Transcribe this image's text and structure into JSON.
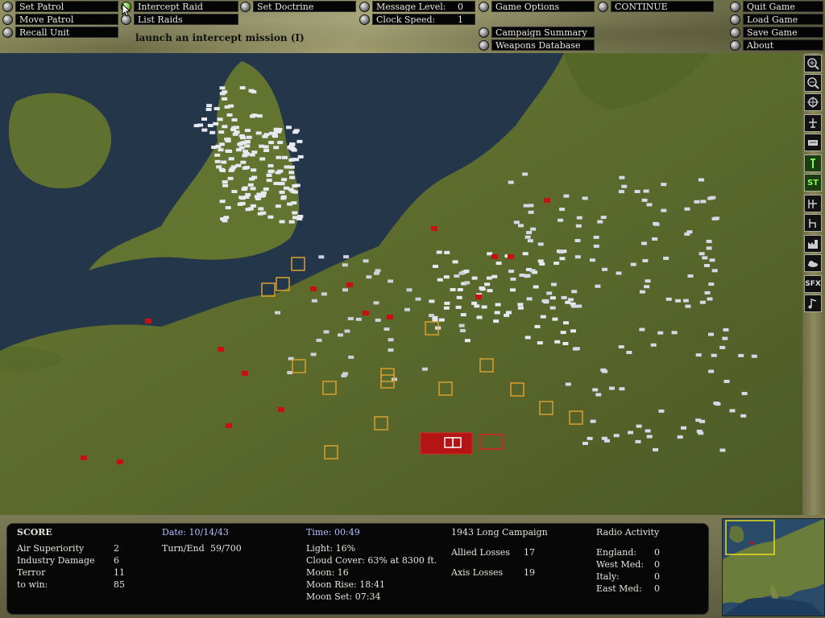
{
  "toolbar": {
    "set_patrol": "Set Patrol",
    "move_patrol": "Move Patrol",
    "recall_unit": "Recall Unit",
    "intercept_raid": "Intercept Raid",
    "list_raids": "List Raids",
    "set_doctrine": "Set Doctrine",
    "message_level_label": "Message Level:",
    "message_level_value": "0",
    "clock_speed_label": "Clock Speed:",
    "clock_speed_value": "1",
    "game_options": "Game Options",
    "continue": "CONTINUE",
    "campaign_summary": "Campaign Summary",
    "weapons_database": "Weapons Database",
    "quit_game": "Quit Game",
    "load_game": "Load Game",
    "save_game": "Save Game",
    "about": "About",
    "hint": "launch an intercept mission (I)"
  },
  "right_tools": [
    "zoom-in-icon",
    "zoom-out-icon",
    "center-crosshair-icon",
    "airbase-icon",
    "raid-icon",
    "flak-icon",
    "st-toggle",
    "radar-icon",
    "grid-icon",
    "factory-icon",
    "weather-icon",
    "sfx-toggle",
    "music-icon"
  ],
  "right_tool_labels": {
    "st": "ST",
    "sfx": "SFX"
  },
  "status": {
    "score_title": "SCORE",
    "air_superiority_label": "Air Superiority",
    "air_superiority_value": "2",
    "industry_damage_label": "Industry Damage",
    "industry_damage_value": "6",
    "terror_label": "Terror",
    "terror_value": "11",
    "to_win_label": "to win:",
    "to_win_value": "85",
    "date": "Date: 10/14/43",
    "turn_end_label": "Turn/End",
    "turn_end_value": "59/700",
    "time": "Time: 00:49",
    "light": "Light: 16%",
    "cloud_cover": "Cloud Cover: 63% at 8300 ft.",
    "moon": "Moon: 16",
    "moon_rise": "Moon Rise: 18:41",
    "moon_set": "Moon Set: 07:34",
    "campaign": "1943 Long Campaign",
    "allied_losses_label": "Allied Losses",
    "allied_losses_value": "17",
    "axis_losses_label": "Axis Losses",
    "axis_losses_value": "19",
    "radio_title": "Radio Activity",
    "radio": [
      {
        "label": "England:",
        "value": "0"
      },
      {
        "label": "West Med:",
        "value": "0"
      },
      {
        "label": "Italy:",
        "value": "0"
      },
      {
        "label": "East Med:",
        "value": "0"
      }
    ]
  },
  "colors": {
    "sea": "#23364a",
    "land": "#5b6a2c",
    "allied_unit": "#e8e8f0",
    "axis_unit": "#c81010",
    "target_box": "#d8a030",
    "selected_radio": "#6fbf3a"
  }
}
